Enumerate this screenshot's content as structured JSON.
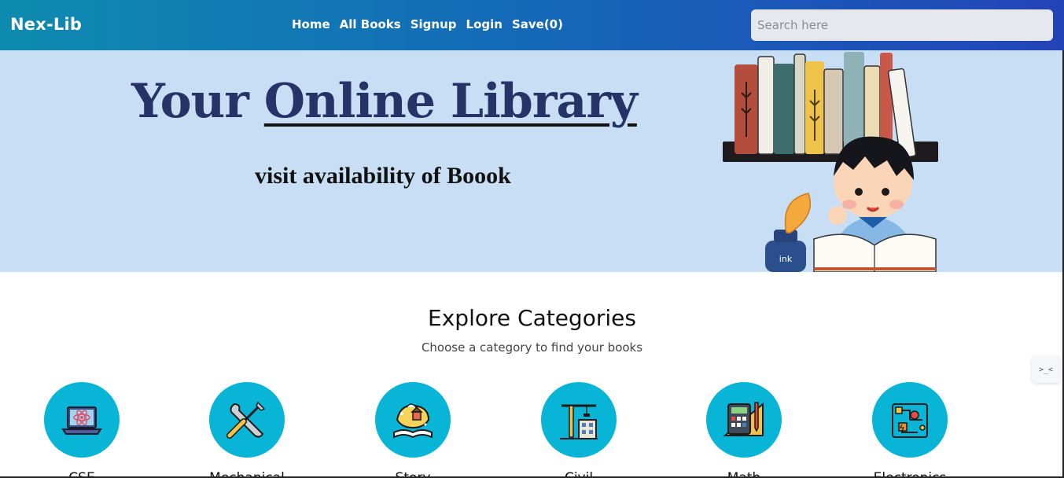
{
  "navbar": {
    "brand": "Nex-Lib",
    "links": [
      "Home",
      "All Books",
      "Signup",
      "Login",
      "Save(0)"
    ],
    "search_placeholder": "Search here"
  },
  "hero": {
    "title_plain": "Your ",
    "title_underlined": "Online Library",
    "subtitle": "visit availability of Boook",
    "ink_label": "ink"
  },
  "explore": {
    "title": "Explore Categories",
    "subtitle": "Choose a category to find your books",
    "categories": [
      {
        "label": "CSE",
        "icon": "laptop-atom-icon"
      },
      {
        "label": "Mechanical",
        "icon": "wrench-screwdriver-icon"
      },
      {
        "label": "Story",
        "icon": "storybook-icon"
      },
      {
        "label": "Civil",
        "icon": "crane-building-icon"
      },
      {
        "label": "Math",
        "icon": "calculator-ruler-icon"
      },
      {
        "label": "Electronics",
        "icon": "circuit-board-icon"
      }
    ]
  },
  "widget": {
    "label": ">_<"
  },
  "colors": {
    "nav_gradient_start": "#0e8bb0",
    "nav_gradient_end": "#2344b8",
    "hero_bg": "#c8def4",
    "hero_title": "#243467",
    "category_circle": "#08b5d6"
  }
}
